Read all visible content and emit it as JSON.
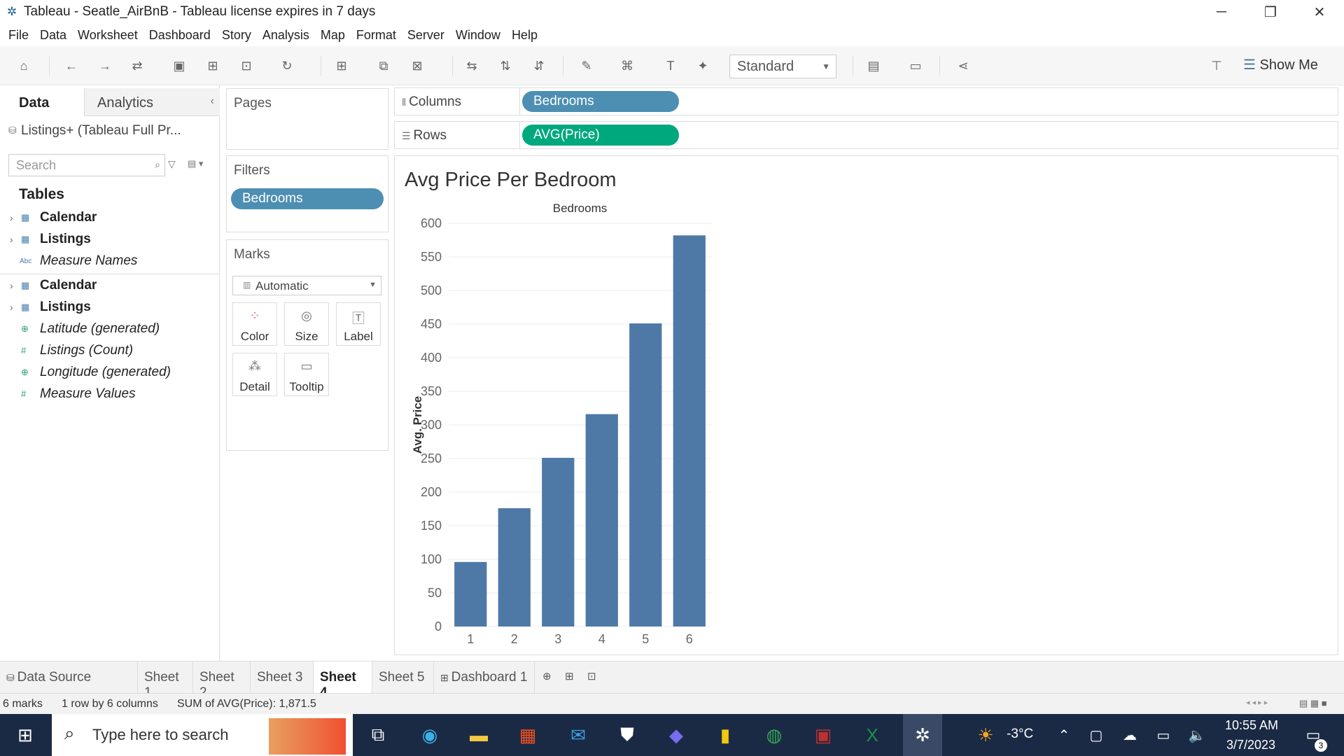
{
  "window": {
    "title": "Tableau - Seatle_AirBnB - Tableau license expires in 7 days",
    "min": "─",
    "max": "❐",
    "close": "✕"
  },
  "menu": [
    "File",
    "Data",
    "Worksheet",
    "Dashboard",
    "Story",
    "Analysis",
    "Map",
    "Format",
    "Server",
    "Window",
    "Help"
  ],
  "toolbar": {
    "standard": "Standard",
    "show_me": "Show Me"
  },
  "left": {
    "tab_data": "Data",
    "tab_analytics": "Analytics",
    "datasource": "Listings+ (Tableau Full Pr...",
    "search_placeholder": "Search",
    "tables_heading": "Tables",
    "fields": [
      {
        "label": "Calendar",
        "icon": "▦"
      },
      {
        "label": "Listings",
        "icon": "▦"
      },
      {
        "label": "Measure Names",
        "icon": "Abc"
      },
      {
        "label": "Calendar",
        "icon": "▦"
      },
      {
        "label": "Listings",
        "icon": "▦"
      },
      {
        "label": "Latitude (generated)",
        "icon": "⊕"
      },
      {
        "label": "Listings (Count)",
        "icon": "#"
      },
      {
        "label": "Longitude (generated)",
        "icon": "⊕"
      },
      {
        "label": "Measure Values",
        "icon": "#"
      }
    ]
  },
  "cards": {
    "pages": "Pages",
    "filters": "Filters",
    "filter_pill": "Bedrooms",
    "marks": "Marks",
    "mark_type": "Automatic",
    "mark_buttons": [
      "Color",
      "Size",
      "Label",
      "Detail",
      "Tooltip"
    ]
  },
  "shelves": {
    "columns_label": "Columns",
    "columns_pill": "Bedrooms",
    "rows_label": "Rows",
    "rows_pill": "AVG(Price)"
  },
  "chart_data": {
    "type": "bar",
    "title": "Avg Price Per Bedroom",
    "xlabel": "Bedrooms",
    "ylabel": "Avg. Price",
    "categories": [
      "1",
      "2",
      "3",
      "4",
      "5",
      "6"
    ],
    "values": [
      96,
      176,
      251,
      316,
      451,
      582
    ],
    "yticks": [
      0,
      50,
      100,
      150,
      200,
      250,
      300,
      350,
      400,
      450,
      500,
      550,
      600
    ],
    "ylim": [
      0,
      600
    ],
    "color": "#4e79a7",
    "grid": true
  },
  "sheet_tabs": [
    "Data Source",
    "Sheet 1",
    "Sheet 2",
    "Sheet 3",
    "Sheet 4",
    "Sheet 5",
    "Dashboard 1"
  ],
  "active_tab": "Sheet 4",
  "status": {
    "marks": "6 marks",
    "rows": "1 row by 6 columns",
    "sum": "SUM of AVG(Price): 1,871.5"
  },
  "taskbar": {
    "search": "Type here to search",
    "temp": "-3°C",
    "time": "10:55 AM",
    "date": "3/7/2023",
    "notif": "3"
  }
}
